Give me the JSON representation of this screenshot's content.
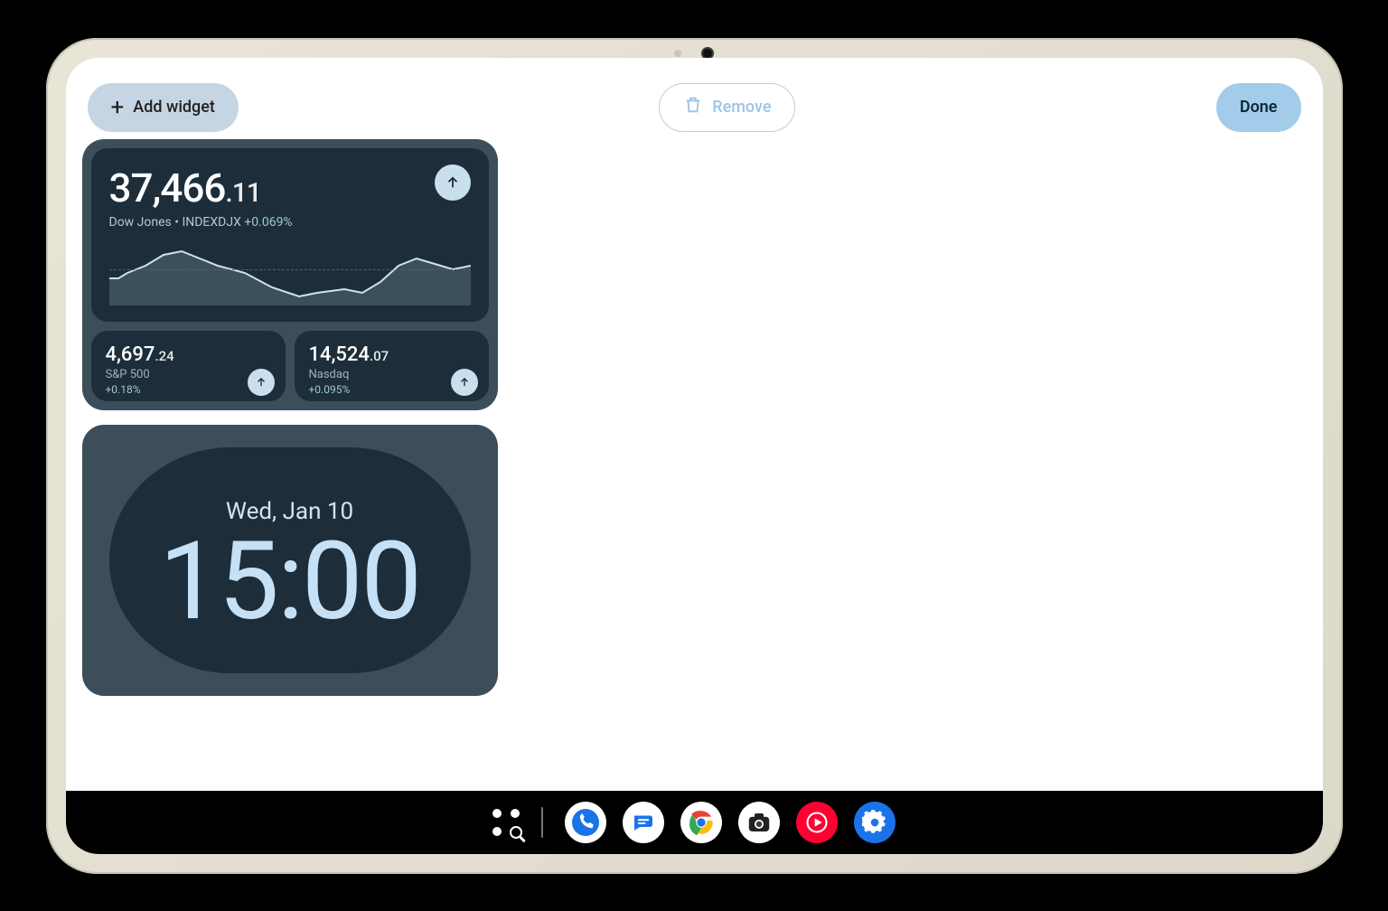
{
  "topbar": {
    "add_widget_label": "Add widget",
    "remove_label": "Remove",
    "done_label": "Done"
  },
  "stocks": {
    "main": {
      "value_int": "37,466",
      "value_frac": ".11",
      "name": "Dow Jones",
      "symbol": "INDEXDJX",
      "pct": "+0.069%"
    },
    "minis": [
      {
        "value_int": "4,697",
        "value_frac": ".24",
        "name": "S&P 500",
        "pct": "+0.18%"
      },
      {
        "value_int": "14,524",
        "value_frac": ".07",
        "name": "Nasdaq",
        "pct": "+0.095%"
      }
    ]
  },
  "clock": {
    "date": "Wed, Jan 10",
    "time": "15:00"
  },
  "chart_data": {
    "type": "line",
    "title": "Dow Jones intraday",
    "xlabel": "",
    "ylabel": "",
    "ylim": [
      37300,
      37600
    ],
    "x": [
      0,
      1,
      2,
      3,
      4,
      5,
      6,
      7,
      8,
      9,
      10,
      11,
      12,
      13,
      14,
      15,
      16,
      17,
      18,
      19
    ],
    "values": [
      37420,
      37440,
      37480,
      37520,
      37540,
      37500,
      37470,
      37440,
      37400,
      37360,
      37330,
      37350,
      37380,
      37360,
      37400,
      37460,
      37500,
      37480,
      37450,
      37470
    ]
  },
  "dock": [
    {
      "name": "app-drawer-search"
    },
    {
      "name": "phone-app"
    },
    {
      "name": "messages-app"
    },
    {
      "name": "chrome-app"
    },
    {
      "name": "camera-app"
    },
    {
      "name": "youtube-music-app"
    },
    {
      "name": "settings-app"
    }
  ]
}
